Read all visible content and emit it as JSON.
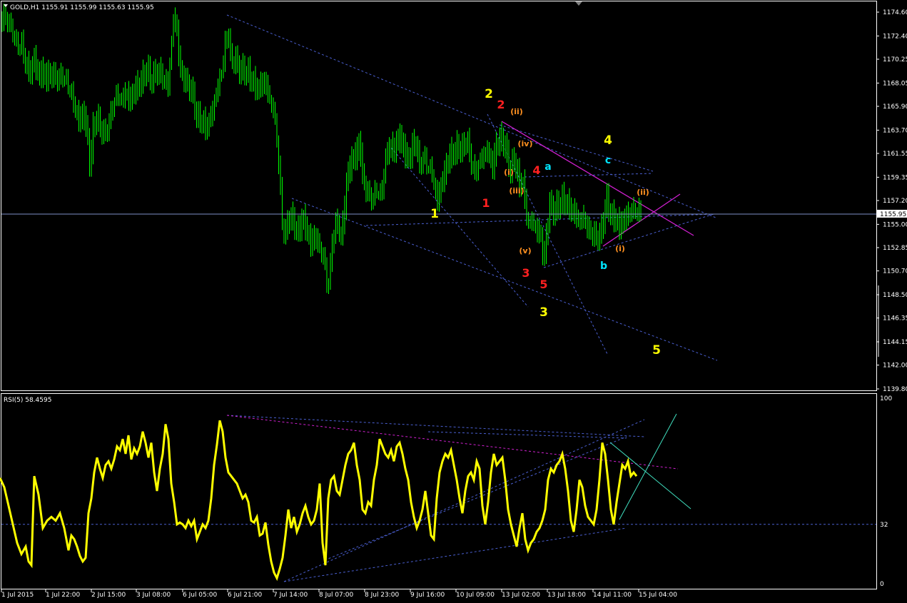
{
  "main_header": "GOLD,H1  1155.91 1155.99 1155.63 1155.95",
  "rsi_header": "RSI(5) 58.4595",
  "price_tag": "1155.95",
  "colors": {
    "background": "#000000",
    "frame": "#ffffff",
    "candle": "#00ff00",
    "rsi_line": "#ffff00",
    "trend_dash": "#4a5fd0",
    "trend_magenta": "#d020d0",
    "trend_cyan": "#40e0c0",
    "price_line": "#8090c8"
  },
  "chart_data": [
    {
      "type": "candlestick",
      "title": "GOLD,H1",
      "ohlc_last": {
        "open": 1155.91,
        "high": 1155.99,
        "low": 1155.63,
        "close": 1155.95
      },
      "y_ticks": [
        "1174.60",
        "1172.40",
        "1170.25",
        "1168.05",
        "1165.90",
        "1163.70",
        "1161.55",
        "1159.35",
        "1157.20",
        "1155.00",
        "1152.85",
        "1150.70",
        "1148.50",
        "1146.35",
        "1144.15",
        "1142.00",
        "1139.80"
      ],
      "ylim": [
        1139.8,
        1175.6
      ],
      "current_price": 1155.95,
      "close_path": [
        [
          0,
          1173.9
        ],
        [
          6,
          1174.2
        ],
        [
          12,
          1173.6
        ],
        [
          18,
          1172.5
        ],
        [
          24,
          1171.2
        ],
        [
          30,
          1171.6
        ],
        [
          36,
          1169.8
        ],
        [
          42,
          1169.0
        ],
        [
          48,
          1170.4
        ],
        [
          54,
          1168.9
        ],
        [
          60,
          1169.2
        ],
        [
          66,
          1168.7
        ],
        [
          72,
          1169.0
        ],
        [
          80,
          1168.4
        ],
        [
          88,
          1168.5
        ],
        [
          96,
          1167.6
        ],
        [
          104,
          1166.0
        ],
        [
          110,
          1164.6
        ],
        [
          116,
          1165.3
        ],
        [
          122,
          1164.1
        ],
        [
          126,
          1160.2
        ],
        [
          130,
          1163.8
        ],
        [
          136,
          1165.1
        ],
        [
          140,
          1164.2
        ],
        [
          146,
          1163.3
        ],
        [
          152,
          1164.0
        ],
        [
          158,
          1165.8
        ],
        [
          164,
          1166.8
        ],
        [
          170,
          1166.1
        ],
        [
          176,
          1167.2
        ],
        [
          182,
          1166.4
        ],
        [
          188,
          1167.4
        ],
        [
          194,
          1168.0
        ],
        [
          200,
          1168.6
        ],
        [
          206,
          1169.6
        ],
        [
          212,
          1168.3
        ],
        [
          218,
          1169.1
        ],
        [
          224,
          1169.0
        ],
        [
          230,
          1168.2
        ],
        [
          236,
          1167.5
        ],
        [
          240,
          1171.3
        ],
        [
          244,
          1174.4
        ],
        [
          248,
          1172.8
        ],
        [
          252,
          1169.4
        ],
        [
          258,
          1168.5
        ],
        [
          264,
          1168.0
        ],
        [
          270,
          1167.2
        ],
        [
          276,
          1165.0
        ],
        [
          282,
          1164.8
        ],
        [
          288,
          1164.0
        ],
        [
          294,
          1164.6
        ],
        [
          300,
          1166.0
        ],
        [
          306,
          1167.7
        ],
        [
          312,
          1169.2
        ],
        [
          316,
          1171.8
        ],
        [
          320,
          1172.6
        ],
        [
          324,
          1169.9
        ],
        [
          330,
          1170.3
        ],
        [
          336,
          1169.3
        ],
        [
          342,
          1169.4
        ],
        [
          348,
          1169.1
        ],
        [
          354,
          1168.3
        ],
        [
          360,
          1167.6
        ],
        [
          366,
          1167.9
        ],
        [
          372,
          1168.1
        ],
        [
          378,
          1166.3
        ],
        [
          384,
          1165.2
        ],
        [
          388,
          1162.6
        ],
        [
          392,
          1159.2
        ],
        [
          396,
          1154.6
        ],
        [
          400,
          1154.1
        ],
        [
          406,
          1156.0
        ],
        [
          412,
          1155.2
        ],
        [
          418,
          1154.4
        ],
        [
          424,
          1155.8
        ],
        [
          430,
          1154.6
        ],
        [
          436,
          1153.2
        ],
        [
          442,
          1154.0
        ],
        [
          448,
          1152.6
        ],
        [
          454,
          1151.7
        ],
        [
          458,
          1149.2
        ],
        [
          462,
          1150.0
        ],
        [
          466,
          1153.6
        ],
        [
          470,
          1154.9
        ],
        [
          474,
          1155.1
        ],
        [
          478,
          1153.8
        ],
        [
          482,
          1156.0
        ],
        [
          486,
          1159.4
        ],
        [
          490,
          1160.4
        ],
        [
          494,
          1161.3
        ],
        [
          500,
          1161.6
        ],
        [
          504,
          1163.0
        ],
        [
          508,
          1159.6
        ],
        [
          512,
          1158.4
        ],
        [
          516,
          1157.8
        ],
        [
          522,
          1157.0
        ],
        [
          528,
          1158.0
        ],
        [
          534,
          1157.3
        ],
        [
          540,
          1160.8
        ],
        [
          546,
          1162.4
        ],
        [
          552,
          1161.8
        ],
        [
          558,
          1163.2
        ],
        [
          564,
          1162.8
        ],
        [
          570,
          1161.1
        ],
        [
          576,
          1161.6
        ],
        [
          582,
          1163.0
        ],
        [
          588,
          1160.3
        ],
        [
          594,
          1161.1
        ],
        [
          600,
          1160.0
        ],
        [
          606,
          1159.6
        ],
        [
          612,
          1157.0
        ],
        [
          618,
          1158.6
        ],
        [
          624,
          1160.1
        ],
        [
          630,
          1161.5
        ],
        [
          636,
          1161.8
        ],
        [
          642,
          1162.3
        ],
        [
          648,
          1162.0
        ],
        [
          654,
          1163.0
        ],
        [
          660,
          1160.8
        ],
        [
          666,
          1159.5
        ],
        [
          672,
          1160.5
        ],
        [
          678,
          1161.2
        ],
        [
          684,
          1161.8
        ],
        [
          690,
          1160.2
        ],
        [
          696,
          1162.5
        ],
        [
          702,
          1163.1
        ],
        [
          708,
          1162.4
        ],
        [
          712,
          1161.0
        ],
        [
          716,
          1160.0
        ],
        [
          720,
          1161.2
        ],
        [
          724,
          1160.3
        ],
        [
          728,
          1158.5
        ],
        [
          732,
          1159.4
        ],
        [
          736,
          1156.8
        ],
        [
          740,
          1154.8
        ],
        [
          746,
          1155.1
        ],
        [
          752,
          1154.3
        ],
        [
          758,
          1153.9
        ],
        [
          762,
          1151.5
        ],
        [
          766,
          1154.2
        ],
        [
          770,
          1157.0
        ],
        [
          776,
          1156.3
        ],
        [
          782,
          1156.9
        ],
        [
          788,
          1157.4
        ],
        [
          794,
          1157.0
        ],
        [
          800,
          1156.4
        ],
        [
          806,
          1155.9
        ],
        [
          812,
          1155.0
        ],
        [
          818,
          1155.4
        ],
        [
          824,
          1154.3
        ],
        [
          830,
          1154.1
        ],
        [
          836,
          1153.8
        ],
        [
          842,
          1154.2
        ],
        [
          846,
          1155.8
        ],
        [
          850,
          1157.6
        ],
        [
          856,
          1155.9
        ],
        [
          862,
          1155.7
        ],
        [
          868,
          1154.9
        ],
        [
          874,
          1155.4
        ],
        [
          880,
          1155.8
        ],
        [
          886,
          1156.1
        ],
        [
          892,
          1155.9
        ],
        [
          898,
          1155.95
        ]
      ],
      "wave_labels": [
        {
          "text": "2",
          "color": "#ffff00"
        },
        {
          "text": "2",
          "color": "#ff2020"
        },
        {
          "text": "(ii)",
          "color": "#ff9020"
        },
        {
          "text": "(iv)",
          "color": "#ff9020"
        },
        {
          "text": "(i)",
          "color": "#ff9020"
        },
        {
          "text": "4",
          "color": "#ff2020"
        },
        {
          "text": "a",
          "color": "#00e5ff"
        },
        {
          "text": "4",
          "color": "#ffff00"
        },
        {
          "text": "c",
          "color": "#00e5ff"
        },
        {
          "text": "(iii)",
          "color": "#ff9020"
        },
        {
          "text": "(ii)",
          "color": "#ff9020"
        },
        {
          "text": "1",
          "color": "#ff2020"
        },
        {
          "text": "1",
          "color": "#ffff00"
        },
        {
          "text": "(v)",
          "color": "#ff9020"
        },
        {
          "text": "(i)",
          "color": "#ff9020"
        },
        {
          "text": "b",
          "color": "#00e5ff"
        },
        {
          "text": "3",
          "color": "#ff2020"
        },
        {
          "text": "5",
          "color": "#ff2020"
        },
        {
          "text": "3",
          "color": "#ffff00"
        },
        {
          "text": "5",
          "color": "#ffff00"
        }
      ]
    },
    {
      "type": "line",
      "title": "RSI(5) 58.4595",
      "last_value": 58.4595,
      "ylim": [
        0,
        100
      ],
      "y_ticks": [
        "100",
        "32",
        "0"
      ],
      "reference_level": 32,
      "x": [
        0,
        6,
        12,
        18,
        24,
        30,
        36,
        40,
        44,
        48,
        54,
        60,
        66,
        72,
        78,
        84,
        90,
        96,
        100,
        104,
        108,
        112,
        116,
        120,
        124,
        128,
        132,
        136,
        140,
        144,
        148,
        152,
        156,
        160,
        164,
        168,
        172,
        176,
        180,
        184,
        188,
        192,
        196,
        200,
        204,
        208,
        212,
        216,
        220,
        224,
        228,
        232,
        236,
        240,
        244,
        248,
        252,
        256,
        260,
        264,
        268,
        272,
        276,
        280,
        284,
        288,
        292,
        296,
        300,
        304,
        308,
        312,
        316,
        320,
        324,
        328,
        332,
        336,
        340,
        344,
        348,
        352,
        356,
        360,
        364,
        368,
        372,
        376,
        380,
        384,
        388,
        392,
        396,
        400,
        404,
        408,
        412,
        416,
        420,
        424,
        428,
        432,
        436,
        440,
        444,
        448,
        452,
        456,
        460,
        464,
        468,
        472,
        476,
        480,
        484,
        488,
        492,
        496,
        500,
        504,
        508,
        512,
        516,
        520,
        524,
        528,
        532,
        536,
        540,
        544,
        548,
        552,
        556,
        560,
        564,
        568,
        572,
        576,
        580,
        584,
        588,
        592,
        596,
        600,
        604,
        608,
        612,
        616,
        620,
        624,
        628,
        632,
        636,
        640,
        644,
        648,
        652,
        656,
        660,
        664,
        668,
        672,
        676,
        680,
        684,
        688,
        692,
        696,
        700,
        704,
        708,
        712,
        716,
        720,
        724,
        728,
        732,
        736,
        740,
        744,
        748,
        752,
        756,
        760,
        764,
        768,
        772,
        776,
        780,
        784,
        788,
        792,
        796,
        800,
        804,
        808,
        812,
        816,
        820,
        824,
        828,
        832,
        836,
        840,
        844,
        848,
        852,
        856,
        860,
        864,
        868,
        872,
        876,
        880,
        884,
        888,
        892,
        896
      ],
      "values": [
        57,
        52,
        42,
        32,
        22,
        16,
        20,
        12,
        10,
        58,
        48,
        30,
        34,
        36,
        34,
        38,
        30,
        18,
        26,
        24,
        20,
        15,
        12,
        14,
        38,
        46,
        60,
        68,
        62,
        57,
        64,
        66,
        62,
        67,
        74,
        72,
        78,
        70,
        80,
        67,
        73,
        70,
        74,
        82,
        76,
        68,
        76,
        60,
        50,
        62,
        70,
        86,
        78,
        54,
        44,
        32,
        33,
        32,
        30,
        34,
        31,
        34,
        24,
        28,
        32,
        30,
        34,
        46,
        64,
        75,
        88,
        82,
        68,
        60,
        58,
        56,
        54,
        50,
        46,
        48,
        44,
        34,
        33,
        36,
        26,
        27,
        33,
        21,
        12,
        6,
        3,
        8,
        14,
        26,
        40,
        30,
        36,
        28,
        32,
        38,
        42,
        36,
        32,
        34,
        40,
        54,
        22,
        10,
        46,
        56,
        58,
        50,
        48,
        56,
        64,
        70,
        72,
        76,
        64,
        56,
        40,
        38,
        44,
        42,
        56,
        64,
        78,
        74,
        70,
        68,
        72,
        66,
        74,
        76,
        70,
        62,
        56,
        44,
        36,
        30,
        34,
        40,
        50,
        38,
        26,
        24,
        46,
        60,
        66,
        70,
        68,
        72,
        64,
        56,
        46,
        38,
        50,
        58,
        60,
        56,
        66,
        62,
        42,
        32,
        44,
        60,
        70,
        64,
        66,
        68,
        56,
        40,
        32,
        26,
        20,
        30,
        38,
        24,
        18,
        22,
        24,
        28,
        30,
        34,
        40,
        56,
        62,
        60,
        64,
        66,
        70,
        62,
        50,
        34,
        28,
        40,
        56,
        52,
        42,
        36,
        34,
        32,
        40,
        56,
        76,
        70,
        56,
        40,
        32,
        44,
        54,
        64,
        62,
        66,
        58,
        60,
        58
      ]
    }
  ],
  "x_labels": [
    "1 Jul 2015",
    "1 Jul 22:00",
    "2 Jul 15:00",
    "3 Jul 08:00",
    "6 Jul 05:00",
    "6 Jul 21:00",
    "7 Jul 14:00",
    "8 Jul 07:00",
    "8 Jul 23:00",
    "9 Jul 16:00",
    "10 Jul 09:00",
    "13 Jul 02:00",
    "13 Jul 18:00",
    "14 Jul 11:00",
    "15 Jul 04:00"
  ]
}
